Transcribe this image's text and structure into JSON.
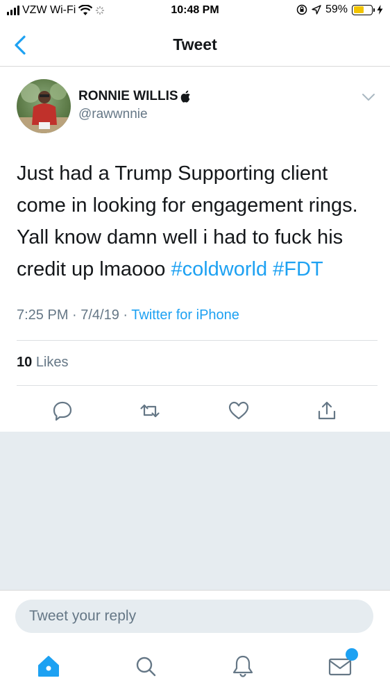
{
  "status_bar": {
    "carrier": "VZW Wi-Fi",
    "time": "10:48 PM",
    "battery_percent": "59%",
    "battery_level": 0.59
  },
  "nav": {
    "title": "Tweet",
    "back_icon": "chevron-left-icon"
  },
  "tweet": {
    "author_name": "RONNIE WILLIS",
    "author_handle": "@rawwnnie",
    "text": "Just had a Trump Supporting client come in looking for engagement rings. Yall know damn well i had to fuck his credit up lmaooo ",
    "hashtags": [
      "#coldworld",
      "#FDT"
    ],
    "time": "7:25 PM · 7/4/19 · ",
    "source": "Twitter for iPhone",
    "likes_count": "10",
    "likes_label": "Likes"
  },
  "reply": {
    "placeholder": "Tweet your reply"
  },
  "tab_bar": {
    "items": [
      "home-icon",
      "search-icon",
      "notifications-icon",
      "messages-icon"
    ],
    "messages_badge": ""
  },
  "colors": {
    "accent": "#1da1f2",
    "text": "#14171a",
    "secondary": "#657786",
    "gray_bg": "#e6ecf0"
  }
}
